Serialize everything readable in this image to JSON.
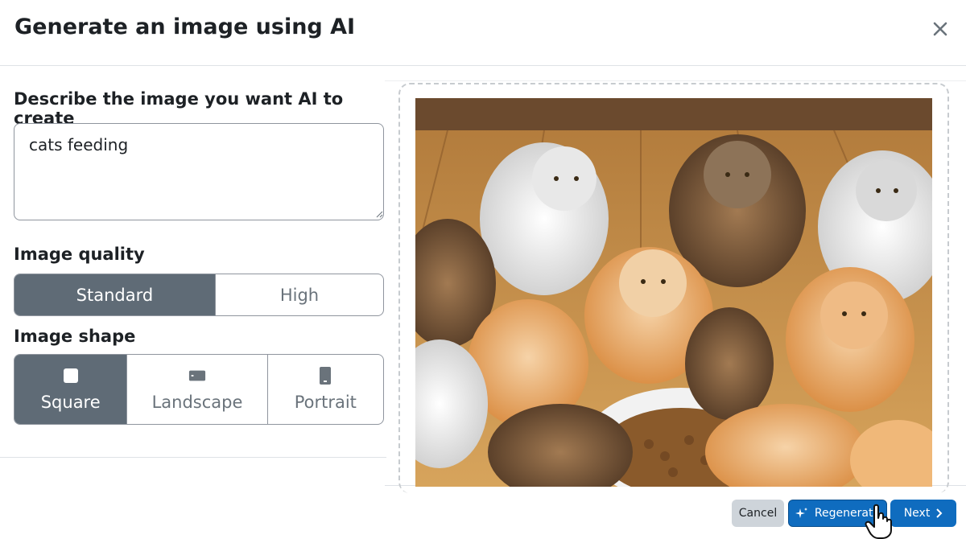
{
  "modal": {
    "title": "Generate an image using AI",
    "close_icon": "close-icon"
  },
  "form": {
    "prompt_label": "Describe the image you want AI to create",
    "prompt_value": "cats feeding",
    "quality_label": "Image quality",
    "quality_options": [
      "Standard",
      "High"
    ],
    "quality_selected": "Standard",
    "shape_label": "Image shape",
    "shape_options": [
      {
        "label": "Square",
        "icon": "square-icon"
      },
      {
        "label": "Landscape",
        "icon": "landscape-icon"
      },
      {
        "label": "Portrait",
        "icon": "portrait-icon"
      }
    ],
    "shape_selected": "Square"
  },
  "preview": {
    "image": "generated-cats-image"
  },
  "footer": {
    "cancel_label": "Cancel",
    "regenerate_label": "Regenerate",
    "next_label": "Next"
  },
  "colors": {
    "primary": "#0f6cbf",
    "selected_segment": "#5f6b76",
    "secondary_button": "#ced4da"
  }
}
